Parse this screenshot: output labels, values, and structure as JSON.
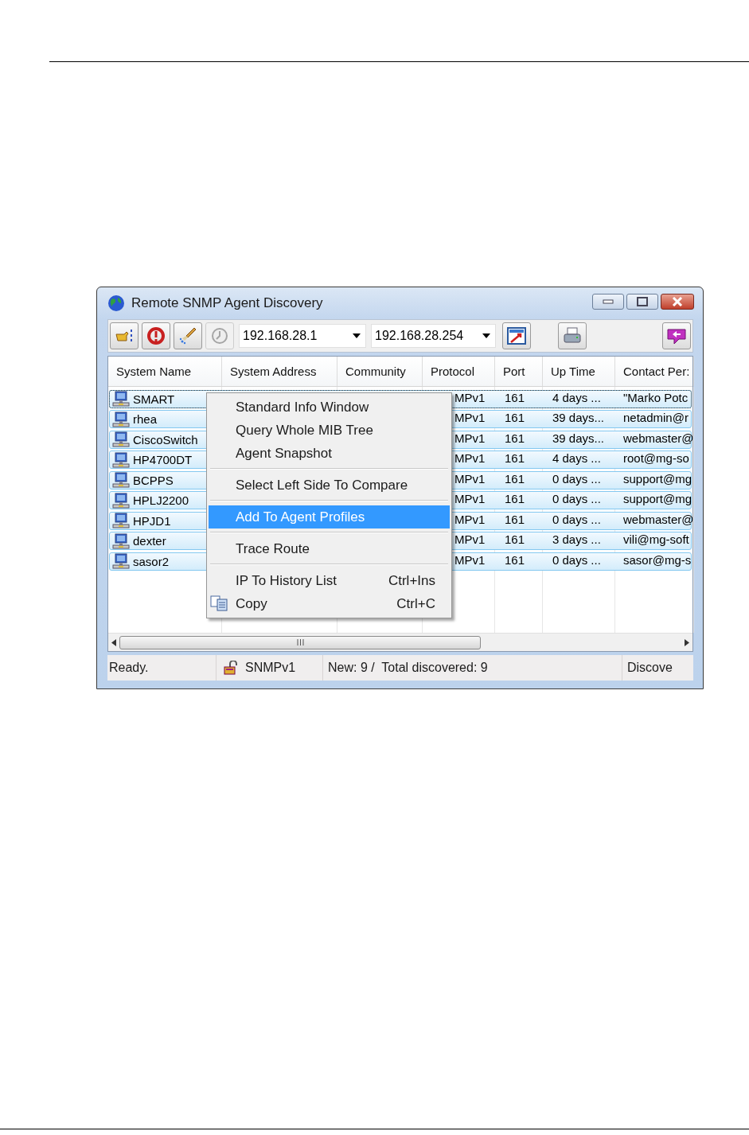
{
  "window": {
    "title": "Remote SNMP Agent Discovery"
  },
  "toolbar": {
    "left_buttons": [
      {
        "disabled": false
      },
      {
        "disabled": false
      },
      {
        "disabled": false
      },
      {
        "disabled": true
      }
    ],
    "range_from": "192.168.28.1",
    "range_to": "192.168.28.254",
    "right_buttons": [
      {
        "disabled": false
      },
      {
        "disabled": false
      },
      {
        "disabled": false
      }
    ]
  },
  "table": {
    "columns": [
      "System Name",
      "System Address",
      "Community",
      "Protocol",
      "Port",
      "Up Time",
      "Contact Per:"
    ],
    "rows": [
      {
        "name": "SMART",
        "selected": true,
        "focused": true,
        "protocol": "MPv1",
        "port": "161",
        "up_time": "4 days ...",
        "contact": "\"Marko Potc"
      },
      {
        "name": "rhea",
        "selected": true,
        "focused": false,
        "protocol": "MPv1",
        "port": "161",
        "up_time": "39 days...",
        "contact": "netadmin@r"
      },
      {
        "name": "CiscoSwitch",
        "selected": true,
        "focused": false,
        "protocol": "MPv1",
        "port": "161",
        "up_time": "39 days...",
        "contact": "webmaster@"
      },
      {
        "name": "HP4700DT",
        "selected": true,
        "focused": false,
        "protocol": "MPv1",
        "port": "161",
        "up_time": "4 days ...",
        "contact": "root@mg-so"
      },
      {
        "name": "BCPPS",
        "selected": true,
        "focused": false,
        "protocol": "MPv1",
        "port": "161",
        "up_time": "0 days ...",
        "contact": "support@mg"
      },
      {
        "name": "HPLJ2200",
        "selected": true,
        "focused": false,
        "protocol": "MPv1",
        "port": "161",
        "up_time": "0 days ...",
        "contact": "support@mg"
      },
      {
        "name": "HPJD1",
        "selected": true,
        "focused": false,
        "protocol": "MPv1",
        "port": "161",
        "up_time": "0 days ...",
        "contact": "webmaster@"
      },
      {
        "name": "dexter",
        "selected": true,
        "focused": false,
        "protocol": "MPv1",
        "port": "161",
        "up_time": "3 days ...",
        "contact": "vili@mg-soft"
      },
      {
        "name": "sasor2",
        "selected": true,
        "focused": false,
        "protocol": "MPv1",
        "port": "161",
        "up_time": "0 days ...",
        "contact": "sasor@mg-s"
      }
    ]
  },
  "context_menu": {
    "items": [
      {
        "kind": "item",
        "label": "Standard Info Window",
        "selected": false,
        "has_icon": false
      },
      {
        "kind": "item",
        "label": "Query Whole MIB Tree",
        "selected": false,
        "has_icon": false
      },
      {
        "kind": "item",
        "label": "Agent Snapshot",
        "selected": false,
        "has_icon": false
      },
      {
        "kind": "separator"
      },
      {
        "kind": "item",
        "label": "Select Left Side To Compare",
        "selected": false,
        "has_icon": false
      },
      {
        "kind": "separator"
      },
      {
        "kind": "item",
        "label": "Add To Agent Profiles",
        "selected": true,
        "has_icon": false
      },
      {
        "kind": "separator"
      },
      {
        "kind": "item",
        "label": "Trace Route",
        "selected": false,
        "has_icon": false
      },
      {
        "kind": "separator"
      },
      {
        "kind": "item",
        "label": "IP To History List",
        "selected": false,
        "shortcut": "Ctrl+Ins",
        "has_icon": false
      },
      {
        "kind": "item",
        "label": "Copy",
        "selected": false,
        "shortcut": "Ctrl+C",
        "has_icon": true
      }
    ]
  },
  "status_bar": {
    "state": "Ready.",
    "protocol": "SNMPv1",
    "counts": "New: 9 /  Total discovered: 9",
    "mode": "Discove"
  }
}
